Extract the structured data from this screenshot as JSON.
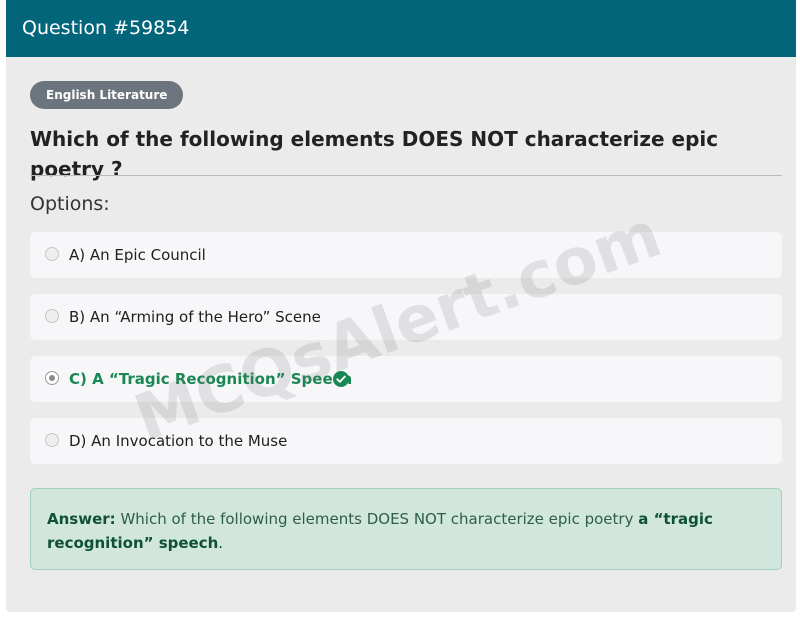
{
  "header": {
    "title": "Question #59854"
  },
  "category_badge": "English Literature",
  "question": "Which of the following elements DOES NOT characterize epic poetry ?",
  "options_heading": "Options:",
  "options": [
    {
      "label": "A) An Epic Council",
      "selected": false,
      "correct": false
    },
    {
      "label": "B) An “Arming of the Hero” Scene",
      "selected": false,
      "correct": false
    },
    {
      "label": "C) A “Tragic Recognition” Speech",
      "selected": true,
      "correct": true
    },
    {
      "label": "D) An Invocation to the Muse",
      "selected": false,
      "correct": false
    }
  ],
  "answer": {
    "label": "Answer:",
    "question_text": "Which of the following elements DOES NOT characterize epic poetry",
    "value": "a “tragic recognition” speech",
    "suffix": "."
  },
  "watermark": "MCQsAlert.com",
  "colors": {
    "header_bg": "#03657a",
    "badge_bg": "#6c757d",
    "correct_green": "#198754",
    "answer_bg": "#d1e7dd"
  },
  "icons": {
    "correct": "check-circle-icon"
  }
}
